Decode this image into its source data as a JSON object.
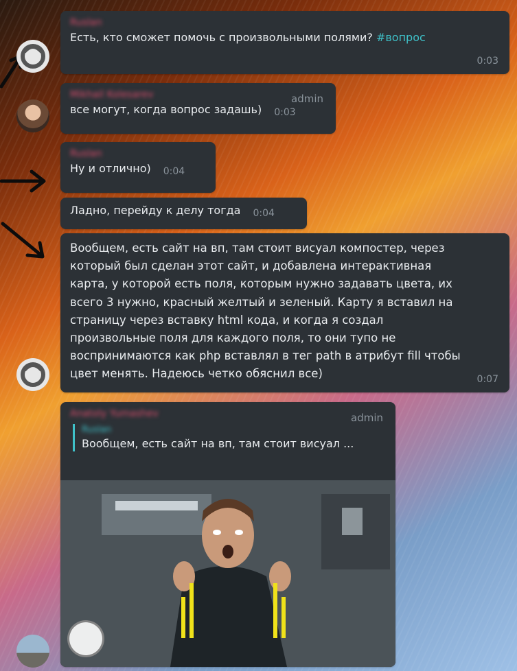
{
  "messages": [
    {
      "author": "Ruslan",
      "text_before": "Есть, кто сможет помочь с произвольными полями? ",
      "hashtag": "#вопрос",
      "time": "0:03"
    },
    {
      "author": "Mikhail Kolesarev",
      "role": "admin",
      "text": "все могут, когда вопрос задашь)",
      "time": "0:03"
    },
    {
      "author": "Ruslan",
      "text": "Ну и отлично)",
      "time": "0:04"
    },
    {
      "text": "Ладно, перейду к делу тогда",
      "time": "0:04"
    },
    {
      "lines": [
        "Вообщем, есть сайт на вп, там стоит висуал компостер, через",
        "который был сделан этот сайт, и добавлена интерактивная",
        "карта, у которой есть поля, которым нужно задавать цвета, их",
        "всего 3 нужно, красный желтый и зеленый. Карту я вставил на",
        "страницу через вставку html кода, и когда я создал",
        "произвольные поля для каждого поля, то они тупо не",
        "воспринимаются как php вставлял в тег path в атрибут fill чтобы",
        "цвет менять. Надеюсь четко обяснил все)"
      ],
      "time": "0:07"
    },
    {
      "author": "Anatoly Yumashev",
      "role": "admin",
      "reply_author": "Ruslan",
      "reply_text": "Вообщем, есть сайт на вп, там стоит висуал ..."
    }
  ],
  "icons": {
    "arrow": "arrow-icon",
    "avatar_logo": "ring-logo-icon",
    "play": "play-icon"
  }
}
